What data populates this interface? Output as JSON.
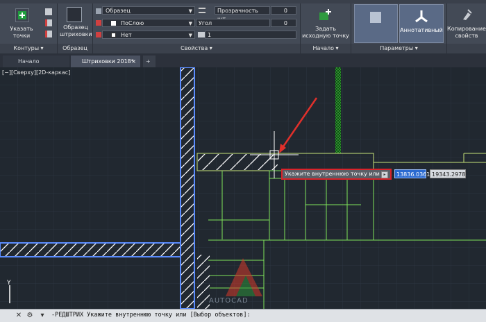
{
  "ribbon": {
    "specify_points": "Указать точки",
    "pattern_sample": "Образец\nштриховки",
    "pattern_combo": "Образец",
    "transparency_label": "Прозрачность шт...",
    "transparency_value": "0",
    "bylayer_combo": "ПоСлою",
    "angle_label": "Угол",
    "angle_value": "0",
    "none_combo": "Нет",
    "scale_value": "1",
    "set_origin": "Задать\nисходную точку",
    "annotative": "Аннотативный",
    "copy_props": "Копирование\nсвойств",
    "panels": {
      "contours": "Контуры",
      "pattern": "Образец",
      "properties": "Свойства",
      "origin": "Начало",
      "parameters": "Параметры"
    }
  },
  "tabs": [
    {
      "label": "Начало"
    },
    {
      "label": "Штриховки 2018*"
    },
    {
      "label": "+"
    }
  ],
  "viewport": {
    "label": "[−][Сверху][2D-каркас]",
    "tooltip": "Укажите внутреннюю точку или",
    "coord_x": "13836.0361",
    "coord_y": "19343.2978",
    "y_axis": "Y",
    "watermark": "AUTOCAD"
  },
  "cmdline": {
    "text": "-РЕДШТРИХ Укажите внутреннюю точку или [Выбор объектов]:"
  },
  "colors": {
    "tooltip_border": "#d8232a",
    "hatch_lines": "#ffffff",
    "green_lines": "#7ee35a",
    "wall_outline": "#5a8cff"
  }
}
